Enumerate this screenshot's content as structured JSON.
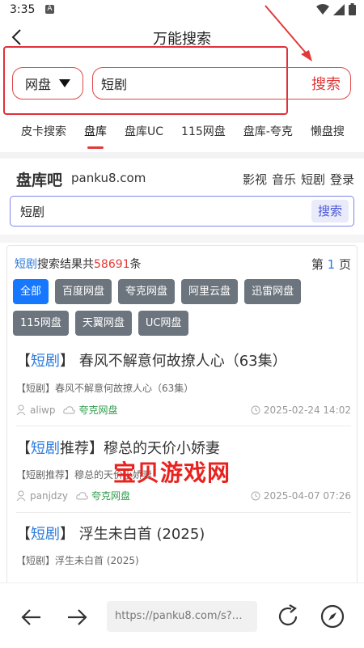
{
  "status_bar": {
    "time": "3:35",
    "notif_letter": "A"
  },
  "top_bar": {
    "title": "万能搜索"
  },
  "search": {
    "source_select": "网盘",
    "query": "短剧",
    "button": "搜索"
  },
  "tabs": [
    {
      "label": "皮卡搜索"
    },
    {
      "label": "盘库"
    },
    {
      "label": "盘库UC"
    },
    {
      "label": "115网盘"
    },
    {
      "label": "盘库-夸克"
    },
    {
      "label": "懒盘搜"
    }
  ],
  "site": {
    "logo": "盘库吧",
    "domain": "panku8.com",
    "nav": [
      "影视",
      "音乐",
      "短剧",
      "登录"
    ],
    "search_value": "短剧",
    "search_button": "搜索"
  },
  "results_summary": {
    "keyword": "短剧",
    "prefix": "搜索结果共",
    "count": "58691",
    "suffix": "条",
    "page_prefix": "第",
    "page": "1",
    "page_suffix": "页"
  },
  "filters": [
    "全部",
    "百度网盘",
    "夸克网盘",
    "阿里云盘",
    "迅雷网盘",
    "115网盘",
    "天翼网盘",
    "UC网盘"
  ],
  "results": [
    {
      "open": "【",
      "hl": "短剧",
      "close": "】",
      "rest": "春风不解意何故撩人心（63集）",
      "sub": "【短剧】春风不解意何故撩人心（63集）",
      "user": "aliwp",
      "disk": "夸克网盘",
      "date": "2025-02-24 14:02"
    },
    {
      "open": "【",
      "hl": "短剧",
      "close": "推荐】",
      "rest": "穆总的天价小娇妻",
      "sub": "【短剧推荐】穆总的天价小娇妻",
      "user": "panjdzy",
      "disk": "夸克网盘",
      "date": "2025-04-07 07:26"
    },
    {
      "open": "【",
      "hl": "短剧",
      "close": "】",
      "rest": "浮生未白首 (2025)",
      "sub": "【短剧】浮生未白首 (2025)"
    }
  ],
  "watermark": "宝贝游戏网",
  "browser": {
    "url": "https://panku8.com/s?…"
  },
  "colors": {
    "red_accent": "#e03a3a",
    "blue_link": "#2d7bdc",
    "chip_gray": "#6c757d",
    "chip_active": "#1677ff",
    "disk_green": "#2e9b4c"
  }
}
